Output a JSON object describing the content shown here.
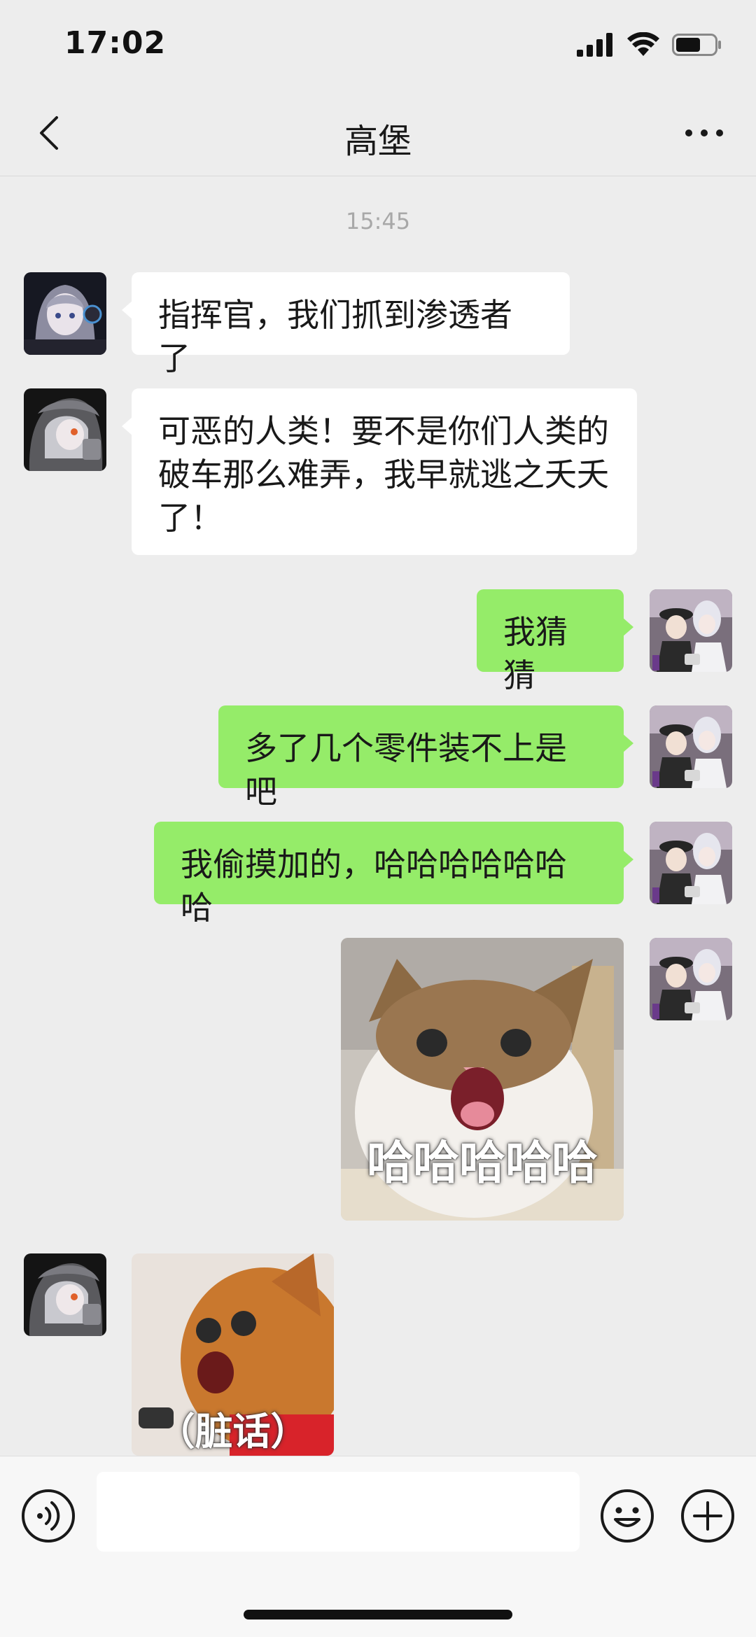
{
  "status_bar": {
    "time": "17:02",
    "icons": [
      "signal-icon",
      "wifi-icon",
      "battery-icon"
    ]
  },
  "nav": {
    "title": "高堡",
    "back_icon": "chevron-left-icon",
    "more_icon": "more-dots-icon"
  },
  "chat": {
    "timestamp": "15:45",
    "messages": [
      {
        "side": "left",
        "avatar": "avatar-gray-haired-girl",
        "text": "指挥官，我们抓到渗透者了"
      },
      {
        "side": "left",
        "avatar": "avatar-hooded-android",
        "text": "可恶的人类！要不是你们人类的破车那么难弄，我早就逃之夭夭了！"
      },
      {
        "side": "right",
        "avatar": "avatar-officer-pair",
        "text": "我猜猜"
      },
      {
        "side": "right",
        "avatar": "avatar-officer-pair",
        "text": "多了几个零件装不上是吧"
      },
      {
        "side": "right",
        "avatar": "avatar-officer-pair",
        "text": "我偷摸加的，哈哈哈哈哈哈哈"
      },
      {
        "side": "right",
        "avatar": "avatar-officer-pair",
        "sticker": "laughing-cat-sticker",
        "caption": "哈哈哈哈哈"
      },
      {
        "side": "left",
        "avatar": "avatar-hooded-android",
        "sticker": "angry-cat-sticker",
        "caption": "（脏话）"
      }
    ]
  },
  "input_bar": {
    "value": "",
    "voice_icon": "voice-icon",
    "emoji_icon": "emoji-icon",
    "plus_icon": "plus-icon"
  },
  "colors": {
    "background": "#ededed",
    "outgoing_bubble": "#95ec69",
    "incoming_bubble": "#ffffff",
    "timestamp": "#a8a8a8"
  }
}
